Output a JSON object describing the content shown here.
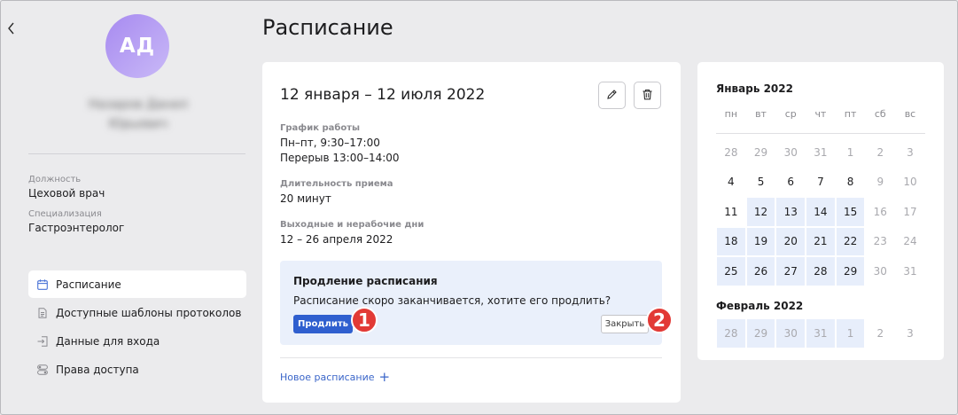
{
  "sidebar": {
    "back_icon": "chevron-left-icon",
    "avatar_initials": "АД",
    "user_name_line1": "Назаров Данил",
    "user_name_line2": "Юрьевич",
    "position_label": "Должность",
    "position_value": "Цеховой врач",
    "specialization_label": "Специализация",
    "specialization_value": "Гастроэнтеролог",
    "menu": [
      {
        "label": "Расписание",
        "icon": "calendar-icon",
        "active": true
      },
      {
        "label": "Доступные шаблоны протоколов",
        "icon": "document-icon",
        "active": false
      },
      {
        "label": "Данные для входа",
        "icon": "login-icon",
        "active": false
      },
      {
        "label": "Права доступа",
        "icon": "toggles-icon",
        "active": false
      }
    ]
  },
  "page": {
    "title": "Расписание"
  },
  "schedule": {
    "period": "12 января – 12 июля 2022",
    "edit_icon": "pencil-icon",
    "delete_icon": "trash-icon",
    "work_label": "График работы",
    "work_line1": "Пн–пт, 9:30–17:00",
    "work_line2": "Перерыв 13:00–14:00",
    "duration_label": "Длительность приема",
    "duration_value": "20 минут",
    "days_off_label": "Выходные и нерабочие дни",
    "days_off_value": "12 – 26 апреля 2022",
    "notice": {
      "title": "Продление расписания",
      "text": "Расписание скоро заканчивается, хотите его продлить?",
      "extend_label": "Продлить",
      "close_label": "Закрыть"
    },
    "markers": [
      "1",
      "2"
    ],
    "new_link": "Новое расписание",
    "new_link_plus": "+"
  },
  "calendar": {
    "weekdays": [
      "пн",
      "вт",
      "ср",
      "чт",
      "пт",
      "сб",
      "вс"
    ],
    "months": [
      {
        "title": "Январь 2022",
        "days": [
          {
            "d": "28",
            "muted": true
          },
          {
            "d": "29",
            "muted": true
          },
          {
            "d": "30",
            "muted": true
          },
          {
            "d": "31",
            "muted": true
          },
          {
            "d": "1",
            "muted": true
          },
          {
            "d": "2",
            "muted": true
          },
          {
            "d": "3",
            "muted": true
          },
          {
            "d": "4"
          },
          {
            "d": "5"
          },
          {
            "d": "6"
          },
          {
            "d": "7"
          },
          {
            "d": "8"
          },
          {
            "d": "9",
            "muted": true
          },
          {
            "d": "10",
            "muted": true
          },
          {
            "d": "11"
          },
          {
            "d": "12",
            "sel": true
          },
          {
            "d": "13",
            "sel": true
          },
          {
            "d": "14",
            "sel": true
          },
          {
            "d": "15",
            "sel": true
          },
          {
            "d": "16",
            "muted": true
          },
          {
            "d": "17",
            "muted": true
          },
          {
            "d": "18",
            "sel": true
          },
          {
            "d": "19",
            "sel": true
          },
          {
            "d": "20",
            "sel": true
          },
          {
            "d": "21",
            "sel": true
          },
          {
            "d": "22",
            "sel": true
          },
          {
            "d": "23",
            "muted": true
          },
          {
            "d": "24",
            "muted": true
          },
          {
            "d": "25",
            "sel": true
          },
          {
            "d": "26",
            "sel": true
          },
          {
            "d": "27",
            "sel": true
          },
          {
            "d": "28",
            "sel": true
          },
          {
            "d": "29",
            "sel": true
          },
          {
            "d": "30",
            "muted": true
          },
          {
            "d": "31",
            "muted": true
          }
        ]
      },
      {
        "title": "Февраль 2022",
        "days": [
          {
            "d": "28",
            "muted": true,
            "sel": true
          },
          {
            "d": "29",
            "muted": true,
            "sel": true
          },
          {
            "d": "30",
            "muted": true,
            "sel": true
          },
          {
            "d": "31",
            "muted": true,
            "sel": true
          },
          {
            "d": "1",
            "muted": true,
            "sel": true
          },
          {
            "d": "2",
            "muted": true
          },
          {
            "d": "3",
            "muted": true
          }
        ]
      }
    ]
  },
  "colors": {
    "accent": "#2f5fcf",
    "selected_day_bg": "#e7eefb",
    "notice_bg": "#eaf0fb",
    "marker": "#e23a36",
    "avatar_gradient_start": "#a78af0"
  }
}
